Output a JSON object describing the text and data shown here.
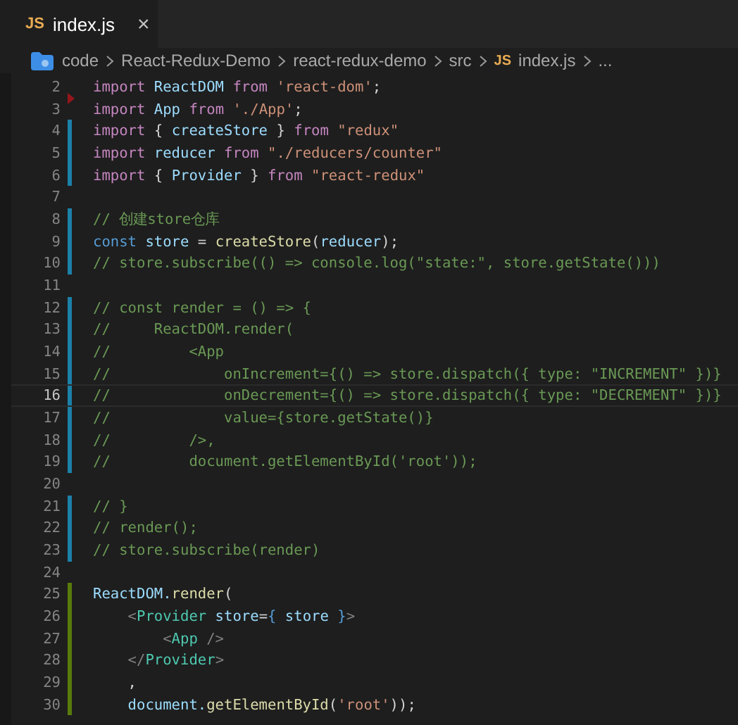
{
  "tab": {
    "icon": "JS",
    "label": "index.js",
    "close": "×",
    "selected": true
  },
  "breadcrumb": [
    {
      "kind": "folder",
      "label": "code"
    },
    {
      "kind": "text",
      "label": "React-Redux-Demo"
    },
    {
      "kind": "text",
      "label": "react-redux-demo"
    },
    {
      "kind": "text",
      "label": "src"
    },
    {
      "kind": "file",
      "icon": "JS",
      "label": "index.js"
    },
    {
      "kind": "text",
      "label": "..."
    }
  ],
  "lines": [
    {
      "n": "2",
      "kind": "deleted",
      "current": false,
      "tokens": [
        {
          "t": "import",
          "kind": "kw"
        },
        {
          "t": " ReactDOM",
          "kind": "var"
        },
        {
          "t": " from ",
          "kind": "kw"
        },
        {
          "t": "'react-dom'",
          "kind": "str"
        },
        {
          "t": ";",
          "kind": "plain"
        }
      ]
    },
    {
      "n": "3",
      "kind": "plain",
      "current": false,
      "tokens": [
        {
          "t": "import",
          "kind": "kw"
        },
        {
          "t": " App",
          "kind": "var"
        },
        {
          "t": " from ",
          "kind": "kw"
        },
        {
          "t": "'./App'",
          "kind": "str"
        },
        {
          "t": ";",
          "kind": "plain"
        }
      ]
    },
    {
      "n": "4",
      "kind": "modified",
      "current": false,
      "tokens": [
        {
          "t": "import",
          "kind": "kw"
        },
        {
          "t": " { ",
          "kind": "plain"
        },
        {
          "t": "createStore",
          "kind": "var"
        },
        {
          "t": " } ",
          "kind": "plain"
        },
        {
          "t": "from ",
          "kind": "kw"
        },
        {
          "t": "\"redux\"",
          "kind": "str"
        }
      ]
    },
    {
      "n": "5",
      "kind": "modified",
      "current": false,
      "tokens": [
        {
          "t": "import",
          "kind": "kw"
        },
        {
          "t": " reducer",
          "kind": "var"
        },
        {
          "t": " from ",
          "kind": "kw"
        },
        {
          "t": "\"./reducers/counter\"",
          "kind": "str"
        }
      ]
    },
    {
      "n": "6",
      "kind": "modified",
      "current": false,
      "tokens": [
        {
          "t": "import",
          "kind": "kw"
        },
        {
          "t": " { ",
          "kind": "plain"
        },
        {
          "t": "Provider",
          "kind": "var"
        },
        {
          "t": " } ",
          "kind": "plain"
        },
        {
          "t": "from ",
          "kind": "kw"
        },
        {
          "t": "\"react-redux\"",
          "kind": "str"
        }
      ]
    },
    {
      "n": "7",
      "kind": "plain",
      "current": false
    },
    {
      "n": "8",
      "kind": "modified",
      "current": false,
      "tokens": [
        {
          "t": "// 创建store仓库",
          "kind": "com"
        }
      ]
    },
    {
      "n": "9",
      "kind": "modified",
      "current": false,
      "tokens": [
        {
          "t": "const",
          "kind": "const"
        },
        {
          "t": " store",
          "kind": "var"
        },
        {
          "t": " = ",
          "kind": "plain"
        },
        {
          "t": "createStore",
          "kind": "fn"
        },
        {
          "t": "(",
          "kind": "plain"
        },
        {
          "t": "reducer",
          "kind": "var"
        },
        {
          "t": ");",
          "kind": "plain"
        }
      ]
    },
    {
      "n": "10",
      "kind": "modified",
      "current": false,
      "tokens": [
        {
          "t": "// store.subscribe(() => console.log(\"state:\", store.getState()))",
          "kind": "com"
        }
      ]
    },
    {
      "n": "11",
      "kind": "plain",
      "current": false
    },
    {
      "n": "12",
      "kind": "modified",
      "current": false,
      "tokens": [
        {
          "t": "// const render = () => {",
          "kind": "com"
        }
      ]
    },
    {
      "n": "13",
      "kind": "modified",
      "current": false,
      "tokens": [
        {
          "t": "//     ReactDOM.render(",
          "kind": "com"
        }
      ]
    },
    {
      "n": "14",
      "kind": "modified",
      "current": false,
      "tokens": [
        {
          "t": "//         <App",
          "kind": "com"
        }
      ]
    },
    {
      "n": "15",
      "kind": "modified",
      "current": false,
      "tokens": [
        {
          "t": "//             onIncrement={() => store.dispatch({ type: \"INCREMENT\" })}",
          "kind": "com"
        }
      ]
    },
    {
      "n": "16",
      "kind": "modified",
      "current": true,
      "tokens": [
        {
          "t": "//             onDecrement={() => store.dispatch({ type: \"DECREMENT\" })}",
          "kind": "com"
        }
      ]
    },
    {
      "n": "17",
      "kind": "modified",
      "current": false,
      "tokens": [
        {
          "t": "//             value={store.getState()}",
          "kind": "com"
        }
      ]
    },
    {
      "n": "18",
      "kind": "modified",
      "current": false,
      "tokens": [
        {
          "t": "//         />,",
          "kind": "com"
        }
      ]
    },
    {
      "n": "19",
      "kind": "modified",
      "current": false,
      "tokens": [
        {
          "t": "//         document.getElementById('root'));",
          "kind": "com"
        }
      ]
    },
    {
      "n": "20",
      "kind": "plain",
      "current": false
    },
    {
      "n": "21",
      "kind": "modified",
      "current": false,
      "tokens": [
        {
          "t": "// }",
          "kind": "com"
        }
      ]
    },
    {
      "n": "22",
      "kind": "modified",
      "current": false,
      "tokens": [
        {
          "t": "// render();",
          "kind": "com"
        }
      ]
    },
    {
      "n": "23",
      "kind": "modified",
      "current": false,
      "tokens": [
        {
          "t": "// store.subscribe(render)",
          "kind": "com"
        }
      ]
    },
    {
      "n": "24",
      "kind": "plain",
      "current": false
    },
    {
      "n": "25",
      "kind": "added",
      "current": false,
      "tokens": [
        {
          "t": "ReactDOM.",
          "kind": "var"
        },
        {
          "t": "render",
          "kind": "fn"
        },
        {
          "t": "(",
          "kind": "plain"
        }
      ]
    },
    {
      "n": "26",
      "kind": "added",
      "current": false,
      "tokens": [
        {
          "t": "    <",
          "kind": "punct"
        },
        {
          "t": "Provider",
          "kind": "tag"
        },
        {
          "t": " store",
          "kind": "var"
        },
        {
          "t": "=",
          "kind": "plain"
        },
        {
          "t": "{",
          "kind": "const"
        },
        {
          "t": " store ",
          "kind": "var"
        },
        {
          "t": "}",
          "kind": "const"
        },
        {
          "t": ">",
          "kind": "punct"
        }
      ]
    },
    {
      "n": "27",
      "kind": "added",
      "current": false,
      "tokens": [
        {
          "t": "        <",
          "kind": "punct"
        },
        {
          "t": "App",
          "kind": "tag"
        },
        {
          "t": " />",
          "kind": "punct"
        }
      ]
    },
    {
      "n": "28",
      "kind": "added",
      "current": false,
      "tokens": [
        {
          "t": "    </",
          "kind": "punct"
        },
        {
          "t": "Provider",
          "kind": "tag"
        },
        {
          "t": ">",
          "kind": "punct"
        }
      ]
    },
    {
      "n": "29",
      "kind": "added",
      "current": false,
      "tokens": [
        {
          "t": "    ,",
          "kind": "plain"
        }
      ]
    },
    {
      "n": "30",
      "kind": "added",
      "current": false,
      "tokens": [
        {
          "t": "    document.",
          "kind": "var"
        },
        {
          "t": "getElementById",
          "kind": "fn"
        },
        {
          "t": "(",
          "kind": "plain"
        },
        {
          "t": "'root'",
          "kind": "str"
        },
        {
          "t": "));",
          "kind": "plain"
        }
      ]
    }
  ]
}
